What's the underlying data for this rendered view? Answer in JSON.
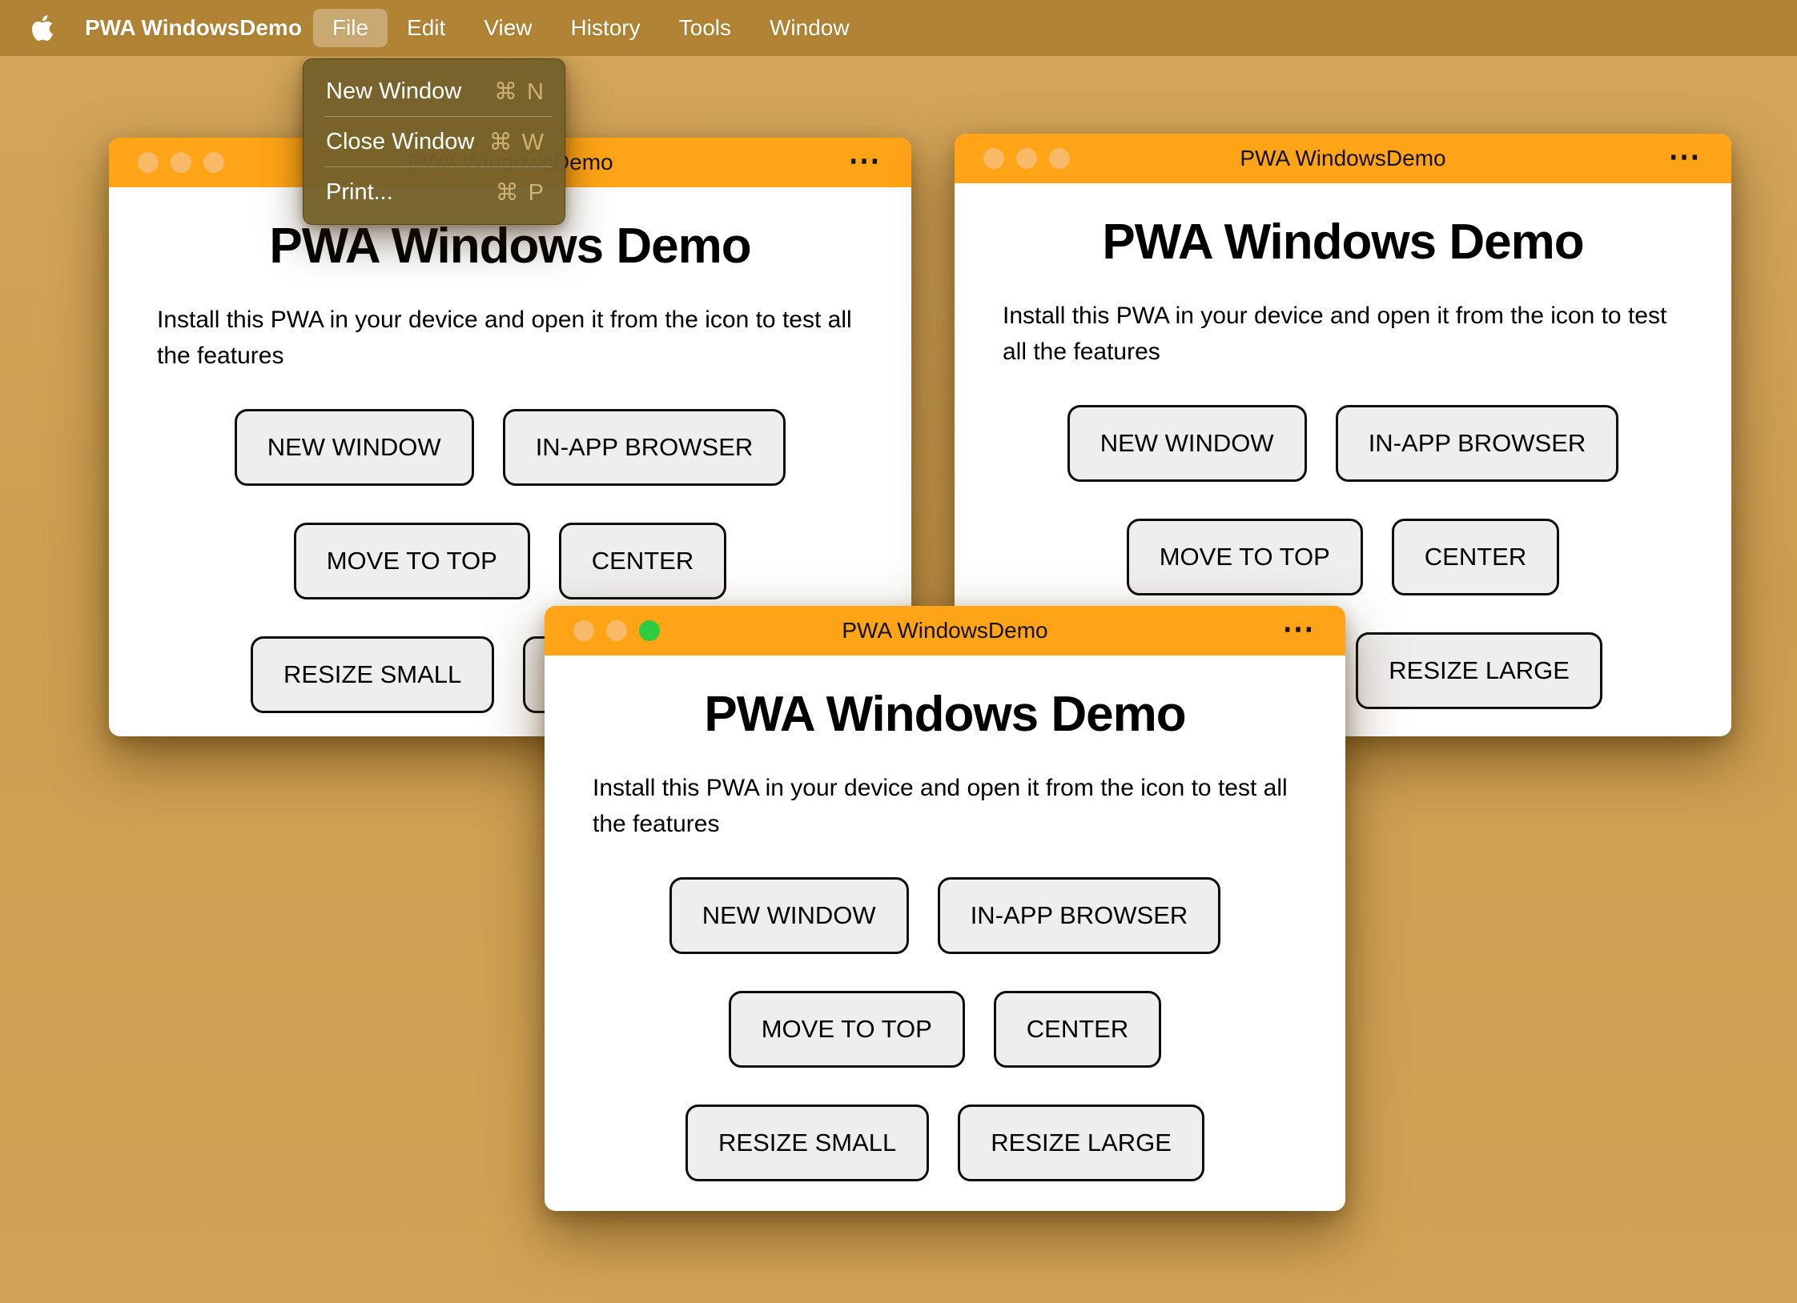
{
  "menu_bar": {
    "app_name": "PWA WindowsDemo",
    "menus": [
      {
        "label": "File",
        "active": true
      },
      {
        "label": "Edit",
        "active": false
      },
      {
        "label": "View",
        "active": false
      },
      {
        "label": "History",
        "active": false
      },
      {
        "label": "Tools",
        "active": false
      },
      {
        "label": "Window",
        "active": false
      }
    ]
  },
  "file_menu": {
    "items": [
      {
        "label": "New Window",
        "shortcut": "⌘ N"
      },
      {
        "label": "Close Window",
        "shortcut": "⌘ W"
      },
      {
        "label": "Print...",
        "shortcut": "⌘ P"
      }
    ]
  },
  "window_chrome": {
    "title": "PWA WindowsDemo",
    "more_icon": "⋯"
  },
  "window_content": {
    "heading": "PWA Windows Demo",
    "description": "Install this PWA in your device and open it from the icon to test all the features",
    "buttons": {
      "new_window": "NEW WINDOW",
      "in_app_browser": "IN-APP BROWSER",
      "move_to_top": "MOVE TO TOP",
      "center": "CENTER",
      "resize_small": "RESIZE SMALL",
      "resize_large": "RESIZE LARGE"
    }
  },
  "colors": {
    "desktop": "#cc9e50",
    "menu_bar": "#b08434",
    "dropdown_bg": "#766128",
    "titlebar_orange": "#ffa417",
    "traffic_inactive": "#f8ba69",
    "traffic_active_green": "#2dcd41",
    "button_bg": "#eeeeee",
    "button_border": "#0d0d0d"
  }
}
